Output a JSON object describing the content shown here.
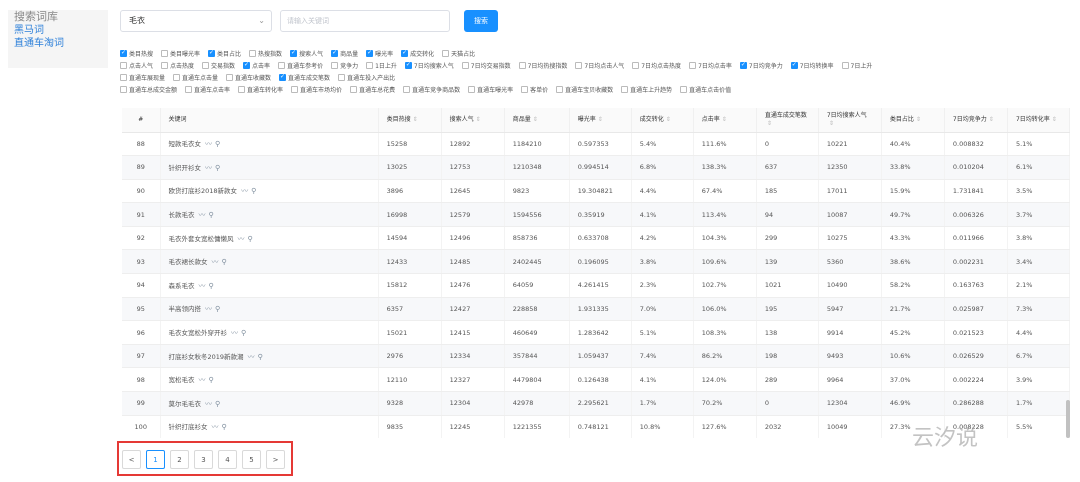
{
  "sidebar": {
    "items": [
      {
        "label": "搜索词库",
        "active": true
      },
      {
        "label": "黑马词",
        "active": false
      },
      {
        "label": "直通车淘词",
        "active": false
      }
    ]
  },
  "search": {
    "category": "毛衣",
    "placeholder": "请输入关键词",
    "button_label": "搜索"
  },
  "filters": [
    [
      {
        "label": "类目热搜",
        "checked": true
      },
      {
        "label": "类目曝光率",
        "checked": false
      },
      {
        "label": "类目占比",
        "checked": true
      },
      {
        "label": "热搜指数",
        "checked": false
      },
      {
        "label": "搜索人气",
        "checked": true
      },
      {
        "label": "商品量",
        "checked": true
      },
      {
        "label": "曝光率",
        "checked": true
      },
      {
        "label": "成交转化",
        "checked": true
      },
      {
        "label": "天猫占比",
        "checked": false
      }
    ],
    [
      {
        "label": "点击人气",
        "checked": false
      },
      {
        "label": "点击热度",
        "checked": false
      },
      {
        "label": "交易指数",
        "checked": false
      },
      {
        "label": "点击率",
        "checked": true
      },
      {
        "label": "直通车参考价",
        "checked": false
      },
      {
        "label": "竞争力",
        "checked": false
      },
      {
        "label": "1日上升",
        "checked": false
      },
      {
        "label": "7日均搜索人气",
        "checked": true
      },
      {
        "label": "7日均交易指数",
        "checked": false
      },
      {
        "label": "7日均热搜指数",
        "checked": false
      },
      {
        "label": "7日均点击人气",
        "checked": false
      },
      {
        "label": "7日均点击热度",
        "checked": false
      },
      {
        "label": "7日均点击率",
        "checked": false
      },
      {
        "label": "7日均竞争力",
        "checked": true
      },
      {
        "label": "7日均转换率",
        "checked": true
      },
      {
        "label": "7日上升",
        "checked": false
      }
    ],
    [
      {
        "label": "直通车展现量",
        "checked": false
      },
      {
        "label": "直通车点击量",
        "checked": false
      },
      {
        "label": "直通车收藏数",
        "checked": false
      },
      {
        "label": "直通车成交笔数",
        "checked": true
      },
      {
        "label": "直通车投入产出比",
        "checked": false
      }
    ],
    [
      {
        "label": "直通车总成交金额",
        "checked": false
      },
      {
        "label": "直通车点击率",
        "checked": false
      },
      {
        "label": "直通车转化率",
        "checked": false
      },
      {
        "label": "直通车市场均价",
        "checked": false
      },
      {
        "label": "直通车总花费",
        "checked": false
      },
      {
        "label": "直通车竞争商品数",
        "checked": false
      },
      {
        "label": "直通车曝光率",
        "checked": false
      },
      {
        "label": "客单价",
        "checked": false
      },
      {
        "label": "直通车宝贝收藏数",
        "checked": false
      },
      {
        "label": "直通车上升趋势",
        "checked": false
      },
      {
        "label": "直通车点击价值",
        "checked": false
      }
    ]
  ],
  "table": {
    "headers": [
      "#",
      "关键词",
      "类目热搜",
      "搜索人气",
      "商品量",
      "曝光率",
      "成交转化",
      "点击率",
      "直通车成交笔数",
      "7日均搜索人气",
      "类目占比",
      "7日均竞争力",
      "7日均转化率"
    ],
    "sortable": [
      false,
      false,
      true,
      true,
      true,
      true,
      true,
      true,
      true,
      true,
      true,
      true,
      true
    ],
    "rows": [
      [
        "88",
        "短款毛衣女",
        "15258",
        "12892",
        "1184210",
        "0.597353",
        "5.4%",
        "111.6%",
        "0",
        "10221",
        "40.4%",
        "0.008832",
        "5.1%"
      ],
      [
        "89",
        "针织开衫女",
        "13025",
        "12753",
        "1210348",
        "0.994514",
        "6.8%",
        "138.3%",
        "637",
        "12350",
        "33.8%",
        "0.010204",
        "6.1%"
      ],
      [
        "90",
        "欧货打底衫2018新款女",
        "3896",
        "12645",
        "9823",
        "19.304821",
        "4.4%",
        "67.4%",
        "185",
        "17011",
        "15.9%",
        "1.731841",
        "3.5%"
      ],
      [
        "91",
        "长款毛衣",
        "16998",
        "12579",
        "1594556",
        "0.35919",
        "4.1%",
        "113.4%",
        "94",
        "10087",
        "49.7%",
        "0.006326",
        "3.7%"
      ],
      [
        "92",
        "毛衣外套女宽松慵懒风",
        "14594",
        "12496",
        "858736",
        "0.633708",
        "4.2%",
        "104.3%",
        "299",
        "10275",
        "43.3%",
        "0.011966",
        "3.8%"
      ],
      [
        "93",
        "毛衣裙长款女",
        "12433",
        "12485",
        "2402445",
        "0.196095",
        "3.8%",
        "109.6%",
        "139",
        "5360",
        "38.6%",
        "0.002231",
        "3.4%"
      ],
      [
        "94",
        "森系毛衣",
        "15812",
        "12476",
        "64059",
        "4.261415",
        "2.3%",
        "102.7%",
        "1021",
        "10490",
        "58.2%",
        "0.163763",
        "2.1%"
      ],
      [
        "95",
        "半高领内搭",
        "6357",
        "12427",
        "228858",
        "1.931335",
        "7.0%",
        "106.0%",
        "195",
        "5947",
        "21.7%",
        "0.025987",
        "7.3%"
      ],
      [
        "96",
        "毛衣女宽松外穿开衫",
        "15021",
        "12415",
        "460649",
        "1.283642",
        "5.1%",
        "108.3%",
        "138",
        "9914",
        "45.2%",
        "0.021523",
        "4.4%"
      ],
      [
        "97",
        "打底衫女秋冬2019新款潮",
        "2976",
        "12334",
        "357844",
        "1.059437",
        "7.4%",
        "86.2%",
        "198",
        "9493",
        "10.6%",
        "0.026529",
        "6.7%"
      ],
      [
        "98",
        "宽松毛衣",
        "12110",
        "12327",
        "4479804",
        "0.126438",
        "4.1%",
        "124.0%",
        "289",
        "9964",
        "37.0%",
        "0.002224",
        "3.9%"
      ],
      [
        "99",
        "莫尔毛毛衣",
        "9328",
        "12304",
        "42978",
        "2.295621",
        "1.7%",
        "70.2%",
        "0",
        "12304",
        "46.9%",
        "0.286288",
        "1.7%"
      ],
      [
        "100",
        "针织打底衫女",
        "9835",
        "12245",
        "1221355",
        "0.748121",
        "10.8%",
        "127.6%",
        "2032",
        "10049",
        "27.3%",
        "0.008228",
        "5.5%"
      ]
    ]
  },
  "pagination": {
    "prev": "<",
    "pages": [
      "1",
      "2",
      "3",
      "4",
      "5"
    ],
    "current": "1",
    "next": ">"
  },
  "watermark": "云汐说",
  "icons": {
    "trend": "trend-icon",
    "search": "search-icon"
  }
}
